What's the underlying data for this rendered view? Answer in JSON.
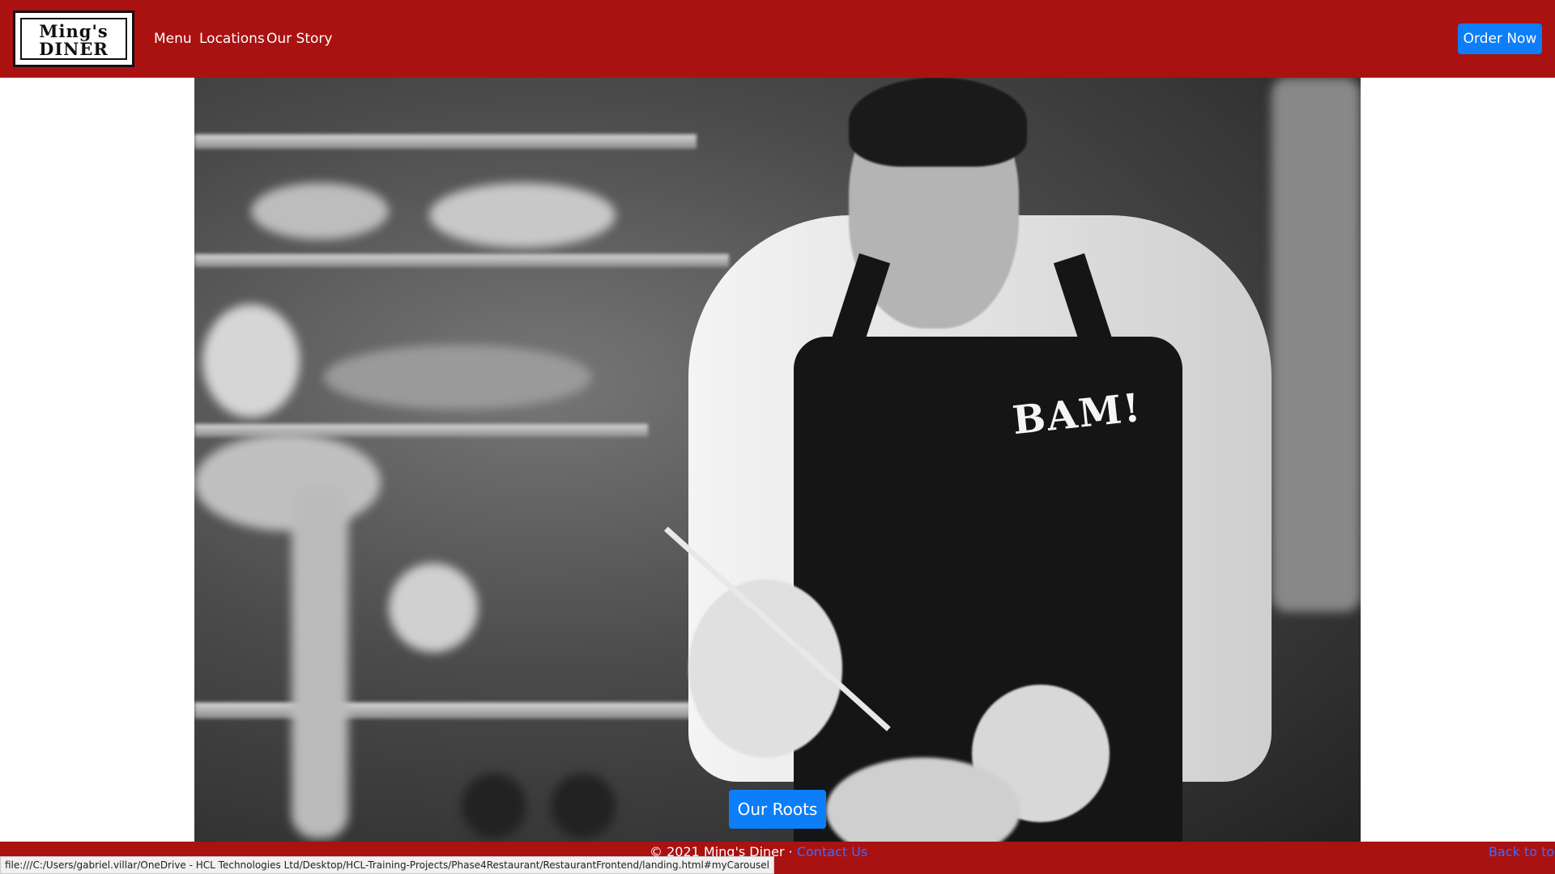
{
  "header": {
    "logo_line1": "Ming's",
    "logo_line2": "Diner",
    "nav": [
      "Menu",
      "Locations",
      "Our Story"
    ],
    "order_button": "Order Now"
  },
  "hero": {
    "apron_text": "BAM!",
    "button_label": "Our Roots"
  },
  "footer": {
    "copyright": "© 2021 Ming's Diner · ",
    "contact": "Contact Us",
    "back_to_top": "Back to top"
  },
  "status_url": "file:///C:/Users/gabriel.villar/OneDrive - HCL Technologies Ltd/Desktop/HCL-Training-Projects/Phase4Restaurant/RestaurantFrontend/landing.html#myCarousel",
  "colors": {
    "brand_red": "#aa1111",
    "button_blue": "#0d7ef8",
    "link_blue": "#3b6cff"
  }
}
